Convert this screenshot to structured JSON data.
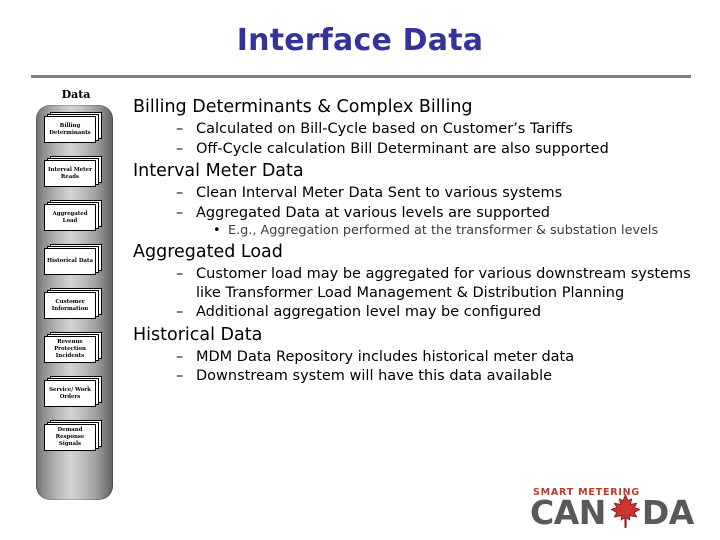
{
  "slide": {
    "title": "Interface Data",
    "title_color": "#333399",
    "rule_color": "#808080"
  },
  "sidebar": {
    "label": "Data",
    "items": [
      {
        "label": "Billing Determinants"
      },
      {
        "label": "Interval Meter Reads"
      },
      {
        "label": "Aggregated Load"
      },
      {
        "label": "Historical Data"
      },
      {
        "label": "Customer Information"
      },
      {
        "label": "Revenue Protection Incidents"
      },
      {
        "label": "Service/ Work Orders"
      },
      {
        "label": "Demand Response Signals"
      }
    ]
  },
  "content": {
    "sections": [
      {
        "heading": "Billing Determinants & Complex Billing",
        "bullets": [
          {
            "level": 1,
            "marker": "–",
            "text": "Calculated on Bill-Cycle based on Customer’s Tariffs"
          },
          {
            "level": 1,
            "marker": "–",
            "text": "Off-Cycle calculation Bill Determinant are also supported"
          }
        ]
      },
      {
        "heading": "Interval Meter Data",
        "bullets": [
          {
            "level": 1,
            "marker": "–",
            "text": "Clean Interval Meter Data Sent to various systems"
          },
          {
            "level": 1,
            "marker": "–",
            "text": "Aggregated Data at various levels are supported"
          },
          {
            "level": 2,
            "marker": "•",
            "text": "E.g., Aggregation performed at the transformer & substation levels"
          }
        ]
      },
      {
        "heading": "Aggregated Load",
        "bullets": [
          {
            "level": 1,
            "marker": "–",
            "text": "Customer load may be aggregated for various downstream systems like Transformer Load Management & Distribution Planning"
          },
          {
            "level": 1,
            "marker": "–",
            "text": "Additional aggregation level may be configured"
          }
        ]
      },
      {
        "heading": "Historical Data",
        "bullets": [
          {
            "level": 1,
            "marker": "–",
            "text": "MDM Data Repository includes historical meter data"
          },
          {
            "level": 1,
            "marker": "–",
            "text": "Downstream system will have this data available"
          }
        ]
      }
    ]
  },
  "logo": {
    "tagline": "SMART METERING",
    "name_left": "CAN",
    "name_right": "DA",
    "tagline_color": "#c0392b",
    "name_color": "#595959",
    "leaf_color": "#cc3333"
  }
}
